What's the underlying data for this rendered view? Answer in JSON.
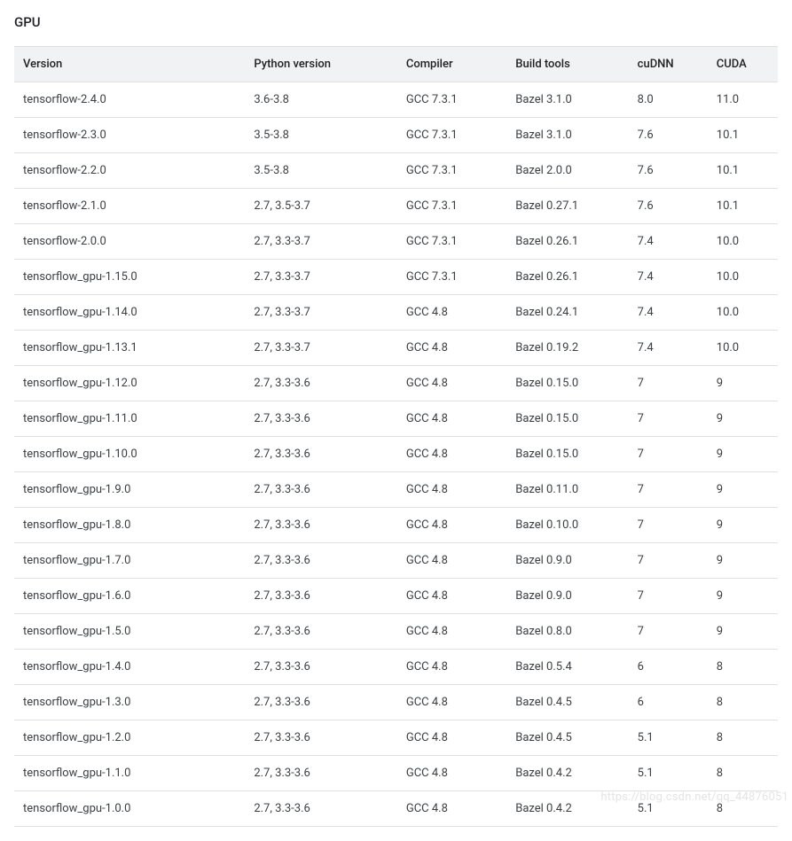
{
  "title": "GPU",
  "columns": [
    "Version",
    "Python version",
    "Compiler",
    "Build tools",
    "cuDNN",
    "CUDA"
  ],
  "rows": [
    {
      "version": "tensorflow-2.4.0",
      "python": "3.6-3.8",
      "compiler": "GCC 7.3.1",
      "build": "Bazel 3.1.0",
      "cudnn": "8.0",
      "cuda": "11.0"
    },
    {
      "version": "tensorflow-2.3.0",
      "python": "3.5-3.8",
      "compiler": "GCC 7.3.1",
      "build": "Bazel 3.1.0",
      "cudnn": "7.6",
      "cuda": "10.1"
    },
    {
      "version": "tensorflow-2.2.0",
      "python": "3.5-3.8",
      "compiler": "GCC 7.3.1",
      "build": "Bazel 2.0.0",
      "cudnn": "7.6",
      "cuda": "10.1"
    },
    {
      "version": "tensorflow-2.1.0",
      "python": "2.7, 3.5-3.7",
      "compiler": "GCC 7.3.1",
      "build": "Bazel 0.27.1",
      "cudnn": "7.6",
      "cuda": "10.1"
    },
    {
      "version": "tensorflow-2.0.0",
      "python": "2.7, 3.3-3.7",
      "compiler": "GCC 7.3.1",
      "build": "Bazel 0.26.1",
      "cudnn": "7.4",
      "cuda": "10.0"
    },
    {
      "version": "tensorflow_gpu-1.15.0",
      "python": "2.7, 3.3-3.7",
      "compiler": "GCC 7.3.1",
      "build": "Bazel 0.26.1",
      "cudnn": "7.4",
      "cuda": "10.0"
    },
    {
      "version": "tensorflow_gpu-1.14.0",
      "python": "2.7, 3.3-3.7",
      "compiler": "GCC 4.8",
      "build": "Bazel 0.24.1",
      "cudnn": "7.4",
      "cuda": "10.0"
    },
    {
      "version": "tensorflow_gpu-1.13.1",
      "python": "2.7, 3.3-3.7",
      "compiler": "GCC 4.8",
      "build": "Bazel 0.19.2",
      "cudnn": "7.4",
      "cuda": "10.0"
    },
    {
      "version": "tensorflow_gpu-1.12.0",
      "python": "2.7, 3.3-3.6",
      "compiler": "GCC 4.8",
      "build": "Bazel 0.15.0",
      "cudnn": "7",
      "cuda": "9"
    },
    {
      "version": "tensorflow_gpu-1.11.0",
      "python": "2.7, 3.3-3.6",
      "compiler": "GCC 4.8",
      "build": "Bazel 0.15.0",
      "cudnn": "7",
      "cuda": "9"
    },
    {
      "version": "tensorflow_gpu-1.10.0",
      "python": "2.7, 3.3-3.6",
      "compiler": "GCC 4.8",
      "build": "Bazel 0.15.0",
      "cudnn": "7",
      "cuda": "9"
    },
    {
      "version": "tensorflow_gpu-1.9.0",
      "python": "2.7, 3.3-3.6",
      "compiler": "GCC 4.8",
      "build": "Bazel 0.11.0",
      "cudnn": "7",
      "cuda": "9"
    },
    {
      "version": "tensorflow_gpu-1.8.0",
      "python": "2.7, 3.3-3.6",
      "compiler": "GCC 4.8",
      "build": "Bazel 0.10.0",
      "cudnn": "7",
      "cuda": "9"
    },
    {
      "version": "tensorflow_gpu-1.7.0",
      "python": "2.7, 3.3-3.6",
      "compiler": "GCC 4.8",
      "build": "Bazel 0.9.0",
      "cudnn": "7",
      "cuda": "9"
    },
    {
      "version": "tensorflow_gpu-1.6.0",
      "python": "2.7, 3.3-3.6",
      "compiler": "GCC 4.8",
      "build": "Bazel 0.9.0",
      "cudnn": "7",
      "cuda": "9"
    },
    {
      "version": "tensorflow_gpu-1.5.0",
      "python": "2.7, 3.3-3.6",
      "compiler": "GCC 4.8",
      "build": "Bazel 0.8.0",
      "cudnn": "7",
      "cuda": "9"
    },
    {
      "version": "tensorflow_gpu-1.4.0",
      "python": "2.7, 3.3-3.6",
      "compiler": "GCC 4.8",
      "build": "Bazel 0.5.4",
      "cudnn": "6",
      "cuda": "8"
    },
    {
      "version": "tensorflow_gpu-1.3.0",
      "python": "2.7, 3.3-3.6",
      "compiler": "GCC 4.8",
      "build": "Bazel 0.4.5",
      "cudnn": "6",
      "cuda": "8"
    },
    {
      "version": "tensorflow_gpu-1.2.0",
      "python": "2.7, 3.3-3.6",
      "compiler": "GCC 4.8",
      "build": "Bazel 0.4.5",
      "cudnn": "5.1",
      "cuda": "8"
    },
    {
      "version": "tensorflow_gpu-1.1.0",
      "python": "2.7, 3.3-3.6",
      "compiler": "GCC 4.8",
      "build": "Bazel 0.4.2",
      "cudnn": "5.1",
      "cuda": "8"
    },
    {
      "version": "tensorflow_gpu-1.0.0",
      "python": "2.7, 3.3-3.6",
      "compiler": "GCC 4.8",
      "build": "Bazel 0.4.2",
      "cudnn": "5.1",
      "cuda": "8"
    }
  ],
  "watermark": "https://blog.csdn.net/qq_44876051"
}
